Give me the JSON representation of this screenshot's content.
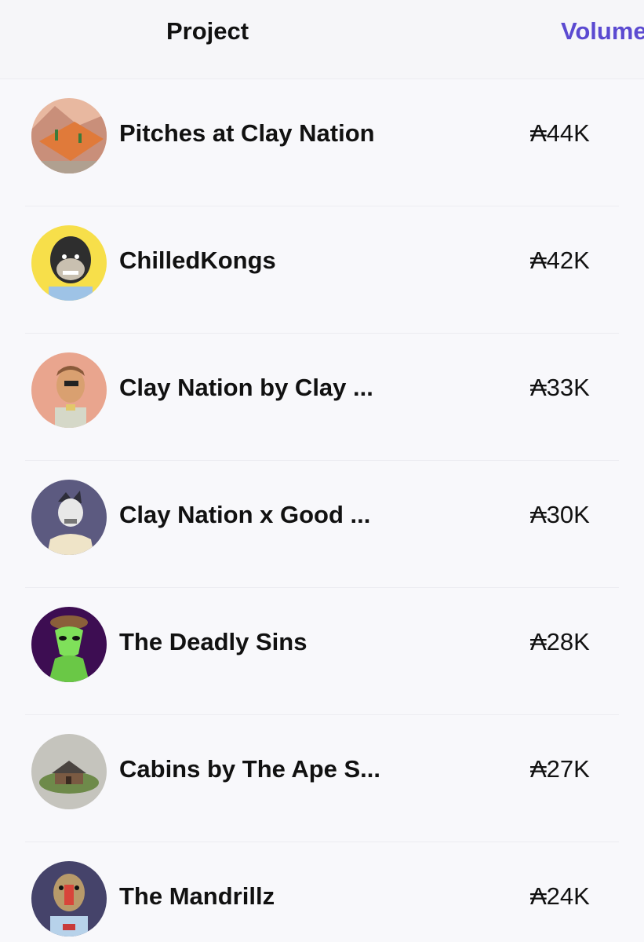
{
  "header": {
    "project_label": "Project",
    "volume_label": "Volume"
  },
  "accent_color": "#5b4ad1",
  "rows": [
    {
      "name": "Pitches at Clay Nation",
      "volume": "₳44K",
      "avatar_icon": "desert-scene-avatar"
    },
    {
      "name": "ChilledKongs",
      "volume": "₳42K",
      "avatar_icon": "gorilla-avatar"
    },
    {
      "name": "Clay Nation by Clay ...",
      "volume": "₳33K",
      "avatar_icon": "clay-pirate-avatar"
    },
    {
      "name": "Clay Nation x Good ...",
      "volume": "₳30K",
      "avatar_icon": "clay-masked-avatar"
    },
    {
      "name": "The Deadly Sins",
      "volume": "₳28K",
      "avatar_icon": "green-alien-avatar"
    },
    {
      "name": "Cabins by The Ape S...",
      "volume": "₳27K",
      "avatar_icon": "cabin-avatar"
    },
    {
      "name": "The Mandrillz",
      "volume": "₳24K",
      "avatar_icon": "mandrill-avatar"
    }
  ]
}
